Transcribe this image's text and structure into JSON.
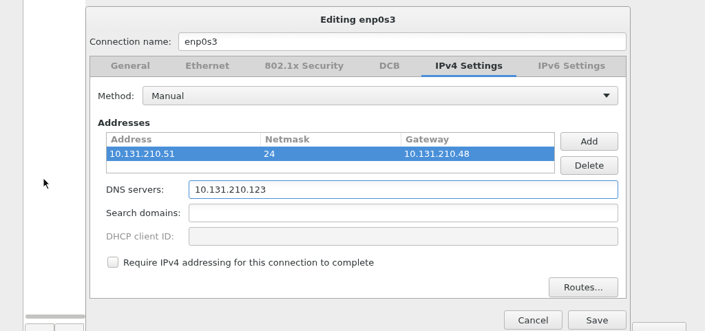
{
  "window": {
    "title": "Editing enp0s3"
  },
  "connection_name": {
    "label": "Connection name:",
    "value": "enp0s3"
  },
  "tabs": [
    {
      "label": "General",
      "selected": false
    },
    {
      "label": "Ethernet",
      "selected": false
    },
    {
      "label": "802.1x Security",
      "selected": false
    },
    {
      "label": "DCB",
      "selected": false
    },
    {
      "label": "IPv4 Settings",
      "selected": true
    },
    {
      "label": "IPv6 Settings",
      "selected": false
    }
  ],
  "method": {
    "label": "Method:",
    "value": "Manual"
  },
  "addresses": {
    "heading": "Addresses",
    "columns": [
      "Address",
      "Netmask",
      "Gateway"
    ],
    "rows": [
      {
        "cells": [
          "10.131.210.51",
          "24",
          "10.131.210.48"
        ],
        "selected": true
      }
    ],
    "buttons": [
      "Add",
      "Delete"
    ]
  },
  "fields": [
    {
      "label": "DNS servers:",
      "value": "10.131.210.123",
      "focused": true,
      "disabled": false
    },
    {
      "label": "Search domains:",
      "focused": false,
      "disabled": false
    },
    {
      "label": "DHCP client ID:",
      "focused": false,
      "disabled": true
    }
  ],
  "require_ipv4": {
    "label": "Require IPv4 addressing for this connection to complete",
    "checked": false
  },
  "routes_button": "Routes...",
  "buttons": [
    "Cancel",
    "Save"
  ]
}
